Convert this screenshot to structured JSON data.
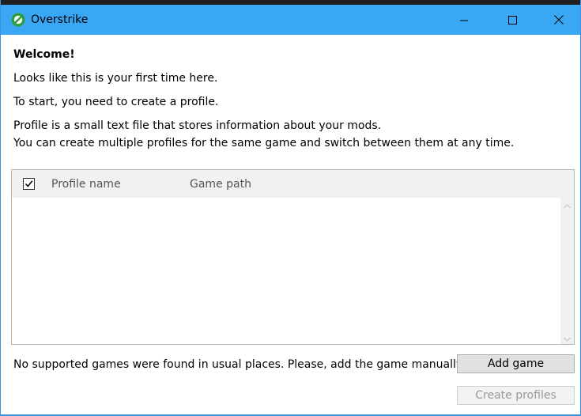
{
  "window": {
    "title": "Overstrike",
    "accent_color": "#3aa7f5"
  },
  "content": {
    "welcome": "Welcome!",
    "line1": "Looks like this is your first time here.",
    "line2": "To start, you need to create a profile.",
    "line3": "Profile is a small text file that stores information about your mods.",
    "line4": "You can create multiple profiles for the same game and switch between them at any time."
  },
  "table": {
    "select_all_checked": true,
    "columns": [
      "Profile name",
      "Game path"
    ],
    "rows": []
  },
  "footer": {
    "message": "No supported games were found in usual places. Please, add the game manually:",
    "add_game_label": "Add game",
    "create_profiles_label": "Create profiles"
  },
  "icons": {
    "app": "overstrike-logo-icon",
    "minimize": "minimize-icon",
    "maximize": "maximize-icon",
    "close": "close-icon",
    "checkbox": "checkmark-icon",
    "scroll_up": "chevron-up-icon",
    "scroll_down": "chevron-down-icon"
  }
}
